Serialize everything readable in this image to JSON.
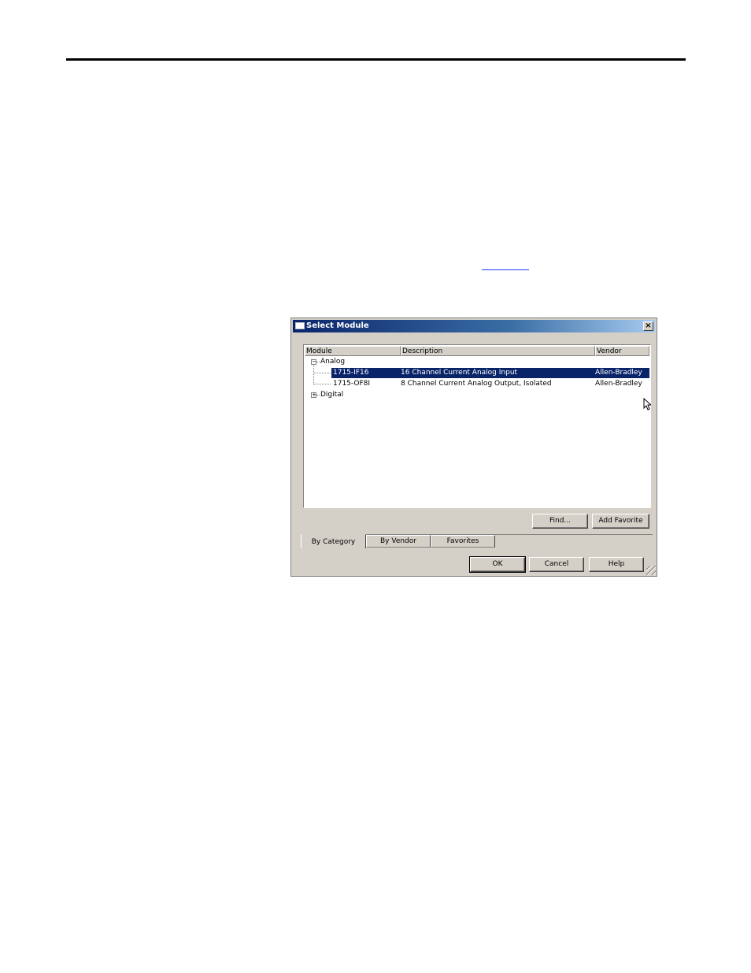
{
  "window": {
    "title": "Select Module",
    "close_glyph": "×"
  },
  "columns": [
    "Module",
    "Description",
    "Vendor"
  ],
  "tree": {
    "analog": {
      "expander": "−",
      "label": "Analog"
    },
    "digital": {
      "expander": "+",
      "label": "Digital"
    }
  },
  "rows": [
    {
      "module": "1715-IF16",
      "description": "16 Channel Current Analog Input",
      "vendor": "Allen-Bradley",
      "selected": true
    },
    {
      "module": "1715-OF8I",
      "description": "8 Channel Current Analog Output, Isolated",
      "vendor": "Allen-Bradley",
      "selected": false
    }
  ],
  "buttons": {
    "find": "Find...",
    "add_favorite": "Add Favorite",
    "ok": "OK",
    "cancel": "Cancel",
    "help": "Help"
  },
  "tabs": [
    "By Category",
    "By Vendor",
    "Favorites"
  ],
  "colors": {
    "selection": "#0a246a",
    "titlebar_start": "#0a246a",
    "dialog_bg": "#d4d0c8"
  }
}
